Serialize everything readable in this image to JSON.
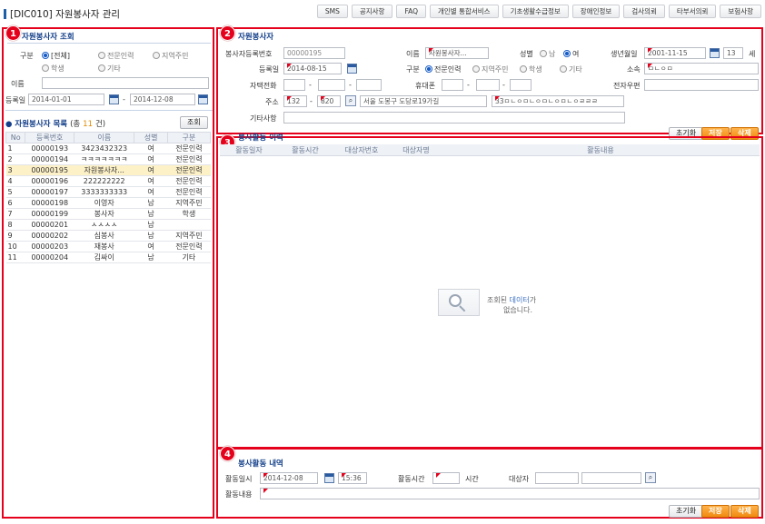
{
  "window": {
    "title": "[DIC010] 자원봉사자 관리"
  },
  "topmenu": [
    "SMS",
    "공지사항",
    "FAQ",
    "개인별 통합서비스",
    "기초생활수급정보",
    "장애인정보",
    "검사의뢰",
    "타부서의뢰",
    "보험사항"
  ],
  "badges": [
    "1",
    "2",
    "3",
    "4"
  ],
  "search": {
    "title": "자원봉사자 조회",
    "type_label": "구분",
    "options": [
      "[전체]",
      "전문인력",
      "지역주민",
      "학생",
      "기타"
    ],
    "name_label": "이름",
    "name_value": "",
    "date_label": "등록일",
    "date_from": "2014-01-01",
    "date_sep": "-",
    "date_to": "2014-12-08"
  },
  "list": {
    "title": "자원봉사자 목록",
    "count_prefix": "(총",
    "count": "11",
    "count_suffix": "건)",
    "search_button": "조회",
    "columns": [
      "No",
      "등록번호",
      "이름",
      "성별",
      "구분"
    ],
    "rows": [
      [
        "1",
        "00000193",
        "3423432323",
        "여",
        "전문인력"
      ],
      [
        "2",
        "00000194",
        "ㅋㅋㅋㅋㅋㅋㅋ",
        "여",
        "전문인력"
      ],
      [
        "3",
        "00000195",
        "자원봉사자...",
        "여",
        "전문인력"
      ],
      [
        "4",
        "00000196",
        "222222222",
        "여",
        "전문인력"
      ],
      [
        "5",
        "00000197",
        "3333333333",
        "여",
        "전문인력"
      ],
      [
        "6",
        "00000198",
        "이영자",
        "남",
        "지역주민"
      ],
      [
        "7",
        "00000199",
        "봉사자",
        "남",
        "학생"
      ],
      [
        "8",
        "00000201",
        "ㅅㅅㅅㅅ",
        "남",
        ""
      ],
      [
        "9",
        "00000202",
        "심봉사",
        "남",
        "지역주민"
      ],
      [
        "10",
        "00000203",
        "재봉사",
        "여",
        "전문인력"
      ],
      [
        "11",
        "00000204",
        "김싸이",
        "남",
        "기타"
      ]
    ]
  },
  "detail": {
    "title": "자원봉사자",
    "reg_no_label": "봉사자등록번호",
    "reg_no": "00000195",
    "name_label": "이름",
    "name": "자원봉사자...",
    "gender_label": "성별",
    "gender_options": [
      "남",
      "여"
    ],
    "birth_label": "생년월일",
    "birth": "2001-11-15",
    "age": "13",
    "age_unit": "세",
    "reg_date_label": "등록일",
    "reg_date": "2014-08-15",
    "type_label": "구분",
    "type_options": [
      "전문인력",
      "지역주민",
      "학생",
      "기타"
    ],
    "affil_label": "소속",
    "affil": "ㅁㄴㅇㅁ",
    "home_phone_label": "자택전화",
    "mobile_label": "휴대폰",
    "email_label": "전자우편",
    "address_label": "주소",
    "zip1": "132",
    "zip2": "820",
    "address1": "서울 도봉구 도당로19가길",
    "address2": "33ㅁㄴㅇㅁㄴㅇㅁㄴㅇㅁㄴㅇㄹㄹㄹ",
    "etc_label": "기타사항",
    "reset_button": "초기화",
    "save_button": "저장",
    "delete_button": "삭제"
  },
  "history": {
    "title": "봉사활동 이력",
    "columns": [
      "활동일자",
      "활동시간",
      "대상자번호",
      "대상자명",
      "활동내용"
    ],
    "empty_line1a": "조회된 ",
    "empty_line1b": "데이터",
    "empty_line1c": "가",
    "empty_line2": "없습니다."
  },
  "activity": {
    "title": "봉사활동 내역",
    "datetime_label": "활동일시",
    "date": "2014-12-08",
    "time": "15:36",
    "hours_label": "활동시간",
    "hours_unit": "시간",
    "target_label": "대상자",
    "content_label": "활동내용",
    "reset_button": "초기화",
    "save_button": "저장",
    "delete_button": "삭제"
  }
}
